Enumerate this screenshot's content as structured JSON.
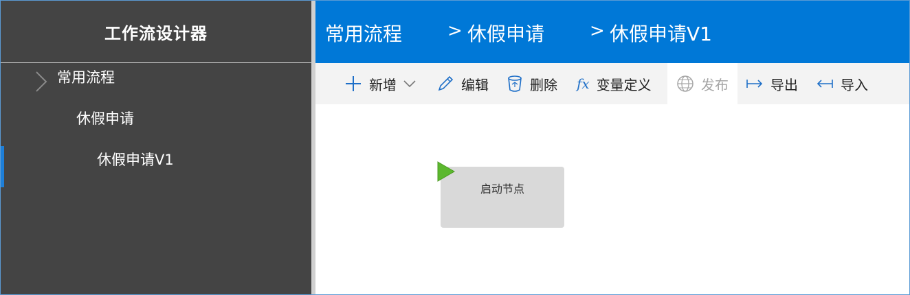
{
  "sidebar": {
    "title": "工作流设计器",
    "tree": {
      "root_label": "常用流程",
      "child_label": "休假申请",
      "leaf_label": "休假申请V1"
    }
  },
  "header": {
    "breadcrumbs": [
      "常用流程",
      "休假申请",
      "休假申请V1"
    ],
    "separator": ">"
  },
  "toolbar": {
    "add_label": "新增",
    "edit_label": "编辑",
    "delete_label": "删除",
    "variables_label": "变量定义",
    "publish_label": "发布",
    "export_label": "导出",
    "import_label": "导入",
    "fx_glyph": "fx"
  },
  "canvas": {
    "nodes": [
      {
        "label": "启动节点",
        "type": "start"
      }
    ]
  },
  "colors": {
    "sidebar_bg": "#444444",
    "header_bg": "#0078d7",
    "toolbar_bg": "#f3f3f3",
    "accent": "#1e7fd8",
    "node_bg": "#d9d9d9",
    "start_icon": "#5cb82e"
  }
}
